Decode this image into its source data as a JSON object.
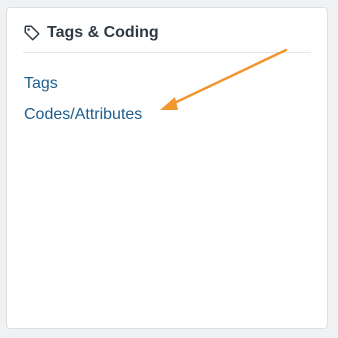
{
  "panel": {
    "title": "Tags & Coding",
    "icon": "tag-icon"
  },
  "links": [
    {
      "label": "Tags"
    },
    {
      "label": "Codes/Attributes"
    }
  ],
  "annotation": {
    "type": "arrow",
    "color": "#f0962f",
    "points_to": "Codes/Attributes"
  }
}
